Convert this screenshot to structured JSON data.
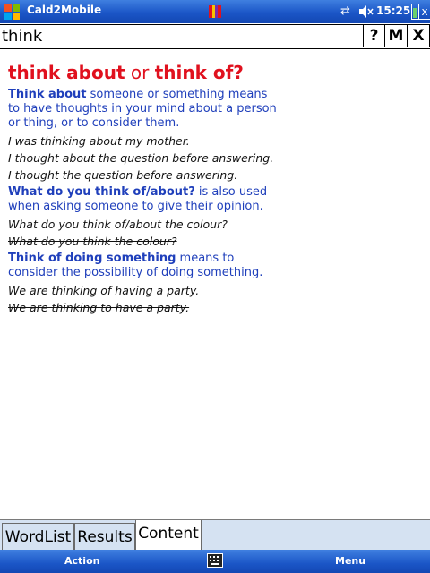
{
  "titlebar": {
    "app_title": "Cald2Mobile",
    "clock": "15:25",
    "close_label": "x",
    "icons": [
      "windows-start-icon",
      "book-icon",
      "sync-icon",
      "volume-muted-icon",
      "battery-icon"
    ]
  },
  "search": {
    "value": "think",
    "help_label": "?",
    "mode_label": "M",
    "clear_label": "X"
  },
  "entry": {
    "heading_a": "think about",
    "heading_or": " or ",
    "heading_b": "think of?",
    "sections": [
      {
        "term": "Think about",
        "definition": " someone or something means to have thoughts in your mind about a person or thing, or to consider them.",
        "examples": [
          "I was thinking about my mother.",
          "I thought about the question before answering."
        ],
        "wrong": "I thought the question before answering."
      },
      {
        "term": "What do you think of/about?",
        "definition": " is also used when asking someone to give their opinion.",
        "examples": [
          "What do you think of/about the colour?"
        ],
        "wrong": "What do you think the colour?"
      },
      {
        "term": "Think of doing something",
        "definition": " means to consider the possibility of doing something.",
        "examples": [
          "We are thinking of having a party."
        ],
        "wrong": "We are thinking to have a party."
      }
    ]
  },
  "tabs": [
    "WordList",
    "Results",
    "Content"
  ],
  "softkeys": {
    "left": "Action",
    "right": "Menu"
  },
  "colors": {
    "heading": "#e0111e",
    "definition": "#1f3fbb",
    "bar": "#1b56c7",
    "tab_bg": "#d5e2f2"
  }
}
